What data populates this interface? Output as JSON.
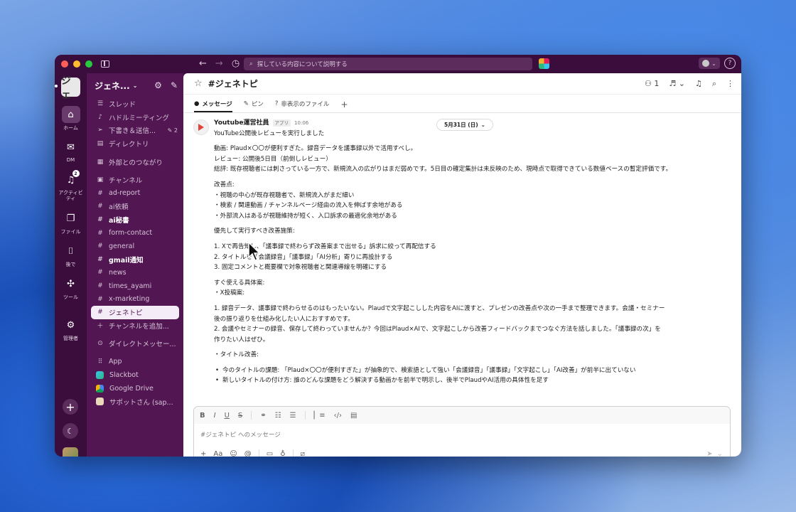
{
  "titlebar": {
    "search_placeholder": "探している内容について説明する"
  },
  "workspace": {
    "icon_text": "ジェ",
    "name": "ジェネ..."
  },
  "rail": {
    "home": "ホーム",
    "dm": "DM",
    "activity": "アクティビティ",
    "activity_badge": "2",
    "files": "ファイル",
    "later": "後で",
    "tools": "ツール",
    "admin": "管理者"
  },
  "sidebar": {
    "top_items": [
      {
        "label": "スレッド"
      },
      {
        "label": "ハドルミーティング"
      },
      {
        "label": "下書き＆送信...",
        "count": "2"
      },
      {
        "label": "ディレクトリ"
      }
    ],
    "external": "外部とのつながり",
    "channels_header": "チャンネル",
    "channels": [
      {
        "label": "ad-report"
      },
      {
        "label": "ai依頼"
      },
      {
        "label": "ai秘書"
      },
      {
        "label": "form-contact"
      },
      {
        "label": "general"
      },
      {
        "label": "gmail通知"
      },
      {
        "label": "news"
      },
      {
        "label": "times_ayami"
      },
      {
        "label": "x-marketing"
      },
      {
        "label": "ジェネトピ"
      }
    ],
    "add_channel": "チャンネルを追加...",
    "dm_header": "ダイレクトメッセー...",
    "app_header": "App",
    "apps": [
      {
        "label": "Slackbot"
      },
      {
        "label": "Google Drive"
      },
      {
        "label": "サポットさん (sap..."
      }
    ]
  },
  "channel": {
    "title": "#ジェネトピ",
    "member_count": "1",
    "tabs": [
      {
        "label": "メッセージ"
      },
      {
        "label": "ピン"
      },
      {
        "label": "非表示のファイル"
      }
    ]
  },
  "message": {
    "sender": "Youtube運営社員",
    "app_tag": "アプリ",
    "time": "10:06",
    "date_pill": "5月31日 (日)",
    "lines": {
      "l1": "YouTube公開後レビューを実行しました",
      "l2": "動画: Plaud×〇〇が便利すぎた。録音データを議事録以外で活用すべし。",
      "l3": "レビュー: 公開後5日目（前倒しレビュー）",
      "l4": "総評: 既存視聴者には刺さっている一方で、新規流入の広がりはまだ弱めです。5日目の確定集計は未反映のため、現時点で取得できている数値ベースの暫定評価です。",
      "l5": "改善点:",
      "l6": "・視聴の中心が既存視聴者で、新規流入がまだ細い",
      "l7": "・検索 / 関連動画 / チャンネルページ経由の流入を伸ばす余地がある",
      "l8": "・外部流入はあるが視聴維持が短く、入口訴求の最適化余地がある",
      "l9": "優先して実行すべき改善施策:",
      "l10": "1. Xで再告知し、「議事録で終わらず改善案まで出せる」訴求に絞って再配信する",
      "l11": "2. タイトルを「会議録音」「議事録」「AI分析」寄りに再設計する",
      "l12": "3. 固定コメントと概要欄で対象視聴者と関連導線を明確にする",
      "l13": "すぐ使える具体案:",
      "l14": "・X投稿案:",
      "l15": "1. 録音データ、議事録で終わらせるのはもったいない。Plaudで文字起こしした内容をAIに渡すと、プレゼンの改善点や次の一手まで整理できます。会議・セミナー",
      "l16": "後の振り返りを仕組み化したい人におすすめです。",
      "l17": "2. 会議やセミナーの録音、保存して終わっていませんか？今回はPlaud×AIで、文字起こしから改善フィードバックまでつなぐ方法を話しました。「議事録の次」を",
      "l18": "作りたい人はぜひ。",
      "l19": "・タイトル改善:",
      "l20": "今のタイトルの課題: 「Plaud×〇〇が便利すぎた」が抽象的で、検索語として強い「会議録音」「議事録」「文字起こし」「AI改善」が前半に出ていない",
      "l21": "新しいタイトルの付け方: 誰のどんな課題をどう解決する動画かを前半で明示し、後半でPlaudやAI活用の具体性を足す"
    }
  },
  "composer": {
    "placeholder": "#ジェネトピ へのメッセージ"
  }
}
